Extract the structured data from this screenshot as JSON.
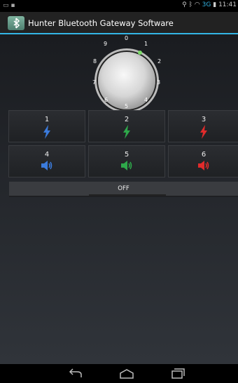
{
  "statusbar": {
    "time": "11:41",
    "network": "3G"
  },
  "app": {
    "title": "Hunter Bluetooth Gateway Software"
  },
  "dial": {
    "numbers": [
      "0",
      "1",
      "2",
      "3",
      "4",
      "5",
      "6",
      "7",
      "8",
      "9"
    ]
  },
  "zones": [
    {
      "label": "1",
      "type": "bolt",
      "color": "#3b7bdc"
    },
    {
      "label": "2",
      "type": "bolt",
      "color": "#2ea84a"
    },
    {
      "label": "3",
      "type": "bolt",
      "color": "#e12b2b"
    },
    {
      "label": "4",
      "type": "speaker",
      "color": "#3b7bdc"
    },
    {
      "label": "5",
      "type": "speaker",
      "color": "#2ea84a"
    },
    {
      "label": "6",
      "type": "speaker",
      "color": "#e12b2b"
    }
  ],
  "off_button": {
    "label": "OFF"
  }
}
